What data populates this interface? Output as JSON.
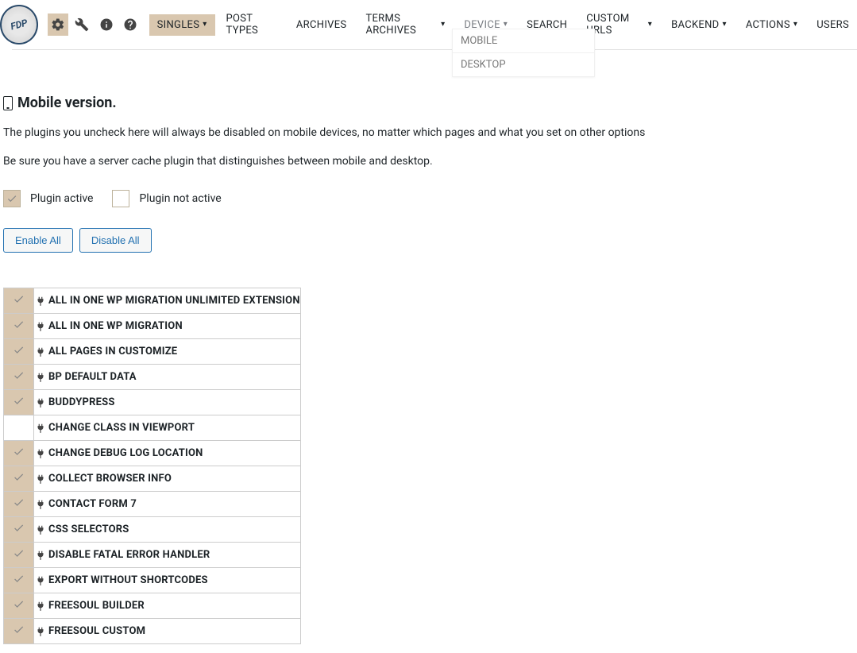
{
  "nav": {
    "singles": "SINGLES",
    "post_types": "POST TYPES",
    "archives": "ARCHIVES",
    "terms_archives": "TERMS ARCHIVES",
    "device": "DEVICE",
    "search": "SEARCH",
    "custom_urls": "CUSTOM URLS",
    "backend": "BACKEND",
    "actions": "ACTIONS",
    "users": "USERS"
  },
  "dropdown": {
    "mobile": "MOBILE",
    "desktop": "DESKTOP"
  },
  "page": {
    "title": "Mobile version.",
    "desc1": "The plugins you uncheck here will always be disabled on mobile devices, no matter which pages and what you set on other options",
    "desc2": "Be sure you have a server cache plugin that distinguishes between mobile and desktop."
  },
  "legend": {
    "active": "Plugin active",
    "inactive": "Plugin not active"
  },
  "buttons": {
    "enable_all": "Enable All",
    "disable_all": "Disable All"
  },
  "plugins": [
    {
      "name": "ALL IN ONE WP MIGRATION UNLIMITED EXTENSION",
      "checked": true
    },
    {
      "name": "ALL IN ONE WP MIGRATION",
      "checked": true
    },
    {
      "name": "ALL PAGES IN CUSTOMIZE",
      "checked": true
    },
    {
      "name": "BP DEFAULT DATA",
      "checked": true
    },
    {
      "name": "BUDDYPRESS",
      "checked": true
    },
    {
      "name": "CHANGE CLASS IN VIEWPORT",
      "checked": false
    },
    {
      "name": "CHANGE DEBUG LOG LOCATION",
      "checked": true
    },
    {
      "name": "COLLECT BROWSER INFO",
      "checked": true
    },
    {
      "name": "CONTACT FORM 7",
      "checked": true
    },
    {
      "name": "CSS SELECTORS",
      "checked": true
    },
    {
      "name": "DISABLE FATAL ERROR HANDLER",
      "checked": true
    },
    {
      "name": "EXPORT WITHOUT SHORTCODES",
      "checked": true
    },
    {
      "name": "FREESOUL BUILDER",
      "checked": true
    },
    {
      "name": "FREESOUL CUSTOM",
      "checked": true
    }
  ]
}
